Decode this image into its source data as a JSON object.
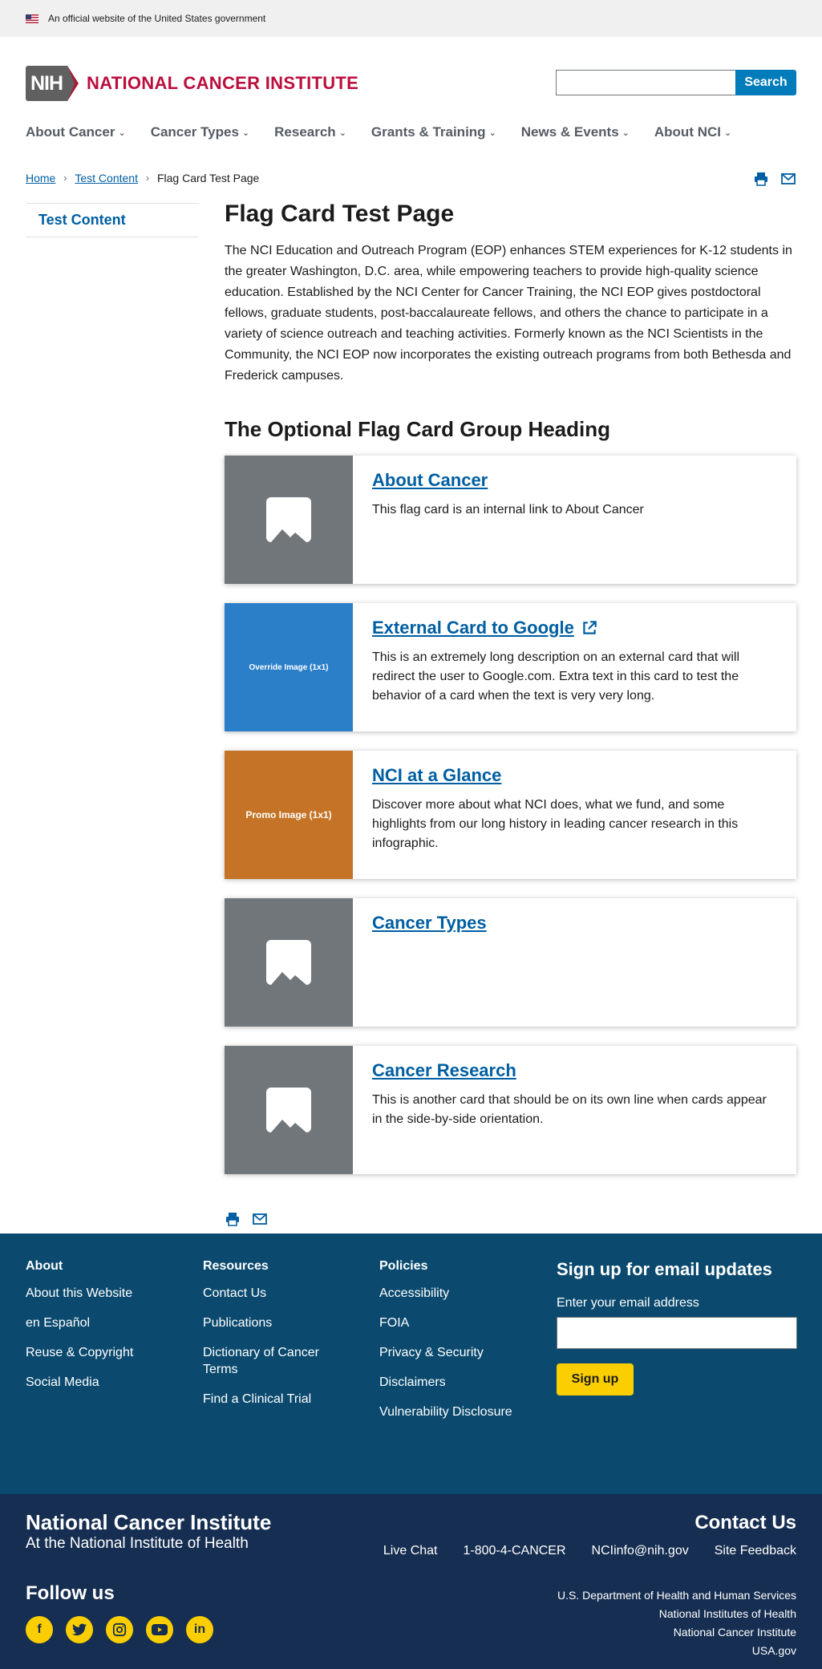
{
  "gov_banner": {
    "text": "An official website of the United States government"
  },
  "header": {
    "logo_mark": "NIH",
    "logo_text": "NATIONAL CANCER INSTITUTE",
    "search_value": "",
    "search_button": "Search"
  },
  "nav": [
    "About Cancer",
    "Cancer Types",
    "Research",
    "Grants & Training",
    "News & Events",
    "About NCI"
  ],
  "breadcrumb": {
    "home": "Home",
    "section": "Test Content",
    "current": "Flag Card Test Page"
  },
  "sidenav": {
    "item": "Test Content"
  },
  "page": {
    "title": "Flag Card Test Page",
    "intro": "The NCI Education and Outreach Program (EOP) enhances STEM experiences for K-12 students in the greater Washington, D.C. area, while empowering teachers to provide high-quality science education. Established by the NCI Center for Cancer Training, the NCI EOP gives postdoctoral fellows, graduate students, post-baccalaureate fellows, and others the chance to participate in a variety of science outreach and teaching activities.  Formerly known as the NCI Scientists in the Community, the NCI EOP now incorporates the existing outreach programs from both Bethesda and Frederick campuses.",
    "group_heading": "The Optional Flag Card Group Heading"
  },
  "cards": [
    {
      "title": "About Cancer",
      "description": "This flag card is an internal link to About Cancer",
      "image_text": ""
    },
    {
      "title": "External Card to Google",
      "description": "This is an extremely long description on an external card that will redirect the user to Google.com. Extra text in this card to test the behavior of a card when the text is very very long.",
      "image_text": "Override Image (1x1)"
    },
    {
      "title": "NCI at a Glance",
      "description": "Discover more about what NCI does, what we fund, and some highlights from our long history in leading cancer research in this infographic.",
      "image_text": "Promo Image (1x1)"
    },
    {
      "title": "Cancer Types",
      "description": "",
      "image_text": ""
    },
    {
      "title": "Cancer Research",
      "description": "This is another card that should be on its own line when cards appear in the side-by-side orientation.",
      "image_text": ""
    }
  ],
  "footer": {
    "about": {
      "heading": "About",
      "links": [
        "About this Website",
        "en Español",
        "Reuse & Copyright",
        "Social Media"
      ]
    },
    "resources": {
      "heading": "Resources",
      "links": [
        "Contact Us",
        "Publications",
        "Dictionary of Cancer Terms",
        "Find a Clinical Trial"
      ]
    },
    "policies": {
      "heading": "Policies",
      "links": [
        "Accessibility",
        "FOIA",
        "Privacy & Security",
        "Disclaimers",
        "Vulnerability Disclosure"
      ]
    },
    "signup": {
      "heading": "Sign up for email updates",
      "label": "Enter your email address",
      "value": "",
      "button": "Sign up"
    }
  },
  "footer_bottom": {
    "org_name": "National Cancer Institute",
    "org_sub": "At the National Institute of Health",
    "contact_title": "Contact Us",
    "contact_links": [
      "Live Chat",
      "1-800-4-CANCER",
      "NCIinfo@nih.gov",
      "Site Feedback"
    ],
    "follow_title": "Follow us",
    "agencies": [
      "U.S. Department of Health and Human Services",
      "National Institutes of Health",
      "National Cancer Institute",
      "USA.gov"
    ]
  },
  "colors": {
    "brand_red": "#bb0e3d",
    "link_blue": "#005ea2",
    "footer_blue": "#0b4a6e",
    "footer_dark": "#162e51",
    "accent_yellow": "#face00"
  }
}
